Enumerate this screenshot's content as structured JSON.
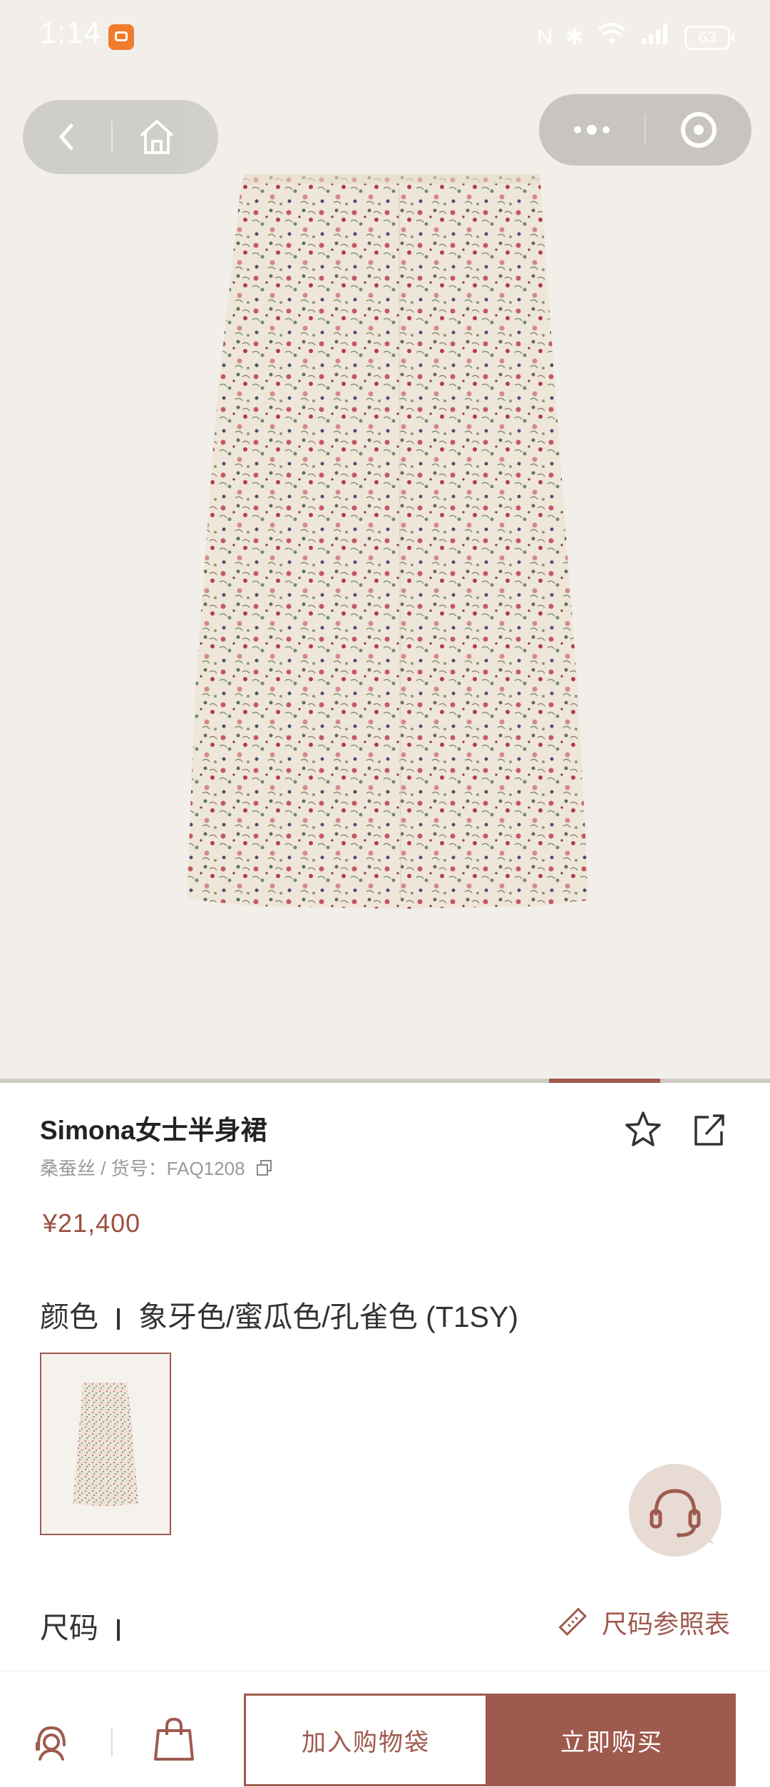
{
  "status_bar": {
    "time": "1:14",
    "battery": "63"
  },
  "product": {
    "name": "Simona女士半身裙",
    "subtitle": "桑蚕丝 / 货号：FAQ1208",
    "price": "¥21,400",
    "color_label": "颜色",
    "color_value": "象牙色/蜜瓜色/孔雀色 (T1SY)",
    "size_label": "尺码",
    "size_guide_label": "尺码参照表"
  },
  "bottom_bar": {
    "add_to_bag": "加入购物袋",
    "buy_now": "立即购买"
  },
  "colors": {
    "accent": "#9f5a4e",
    "price": "#9f4f3f",
    "hero_bg": "#f2efea"
  },
  "gallery": {
    "progress": 0.14
  }
}
